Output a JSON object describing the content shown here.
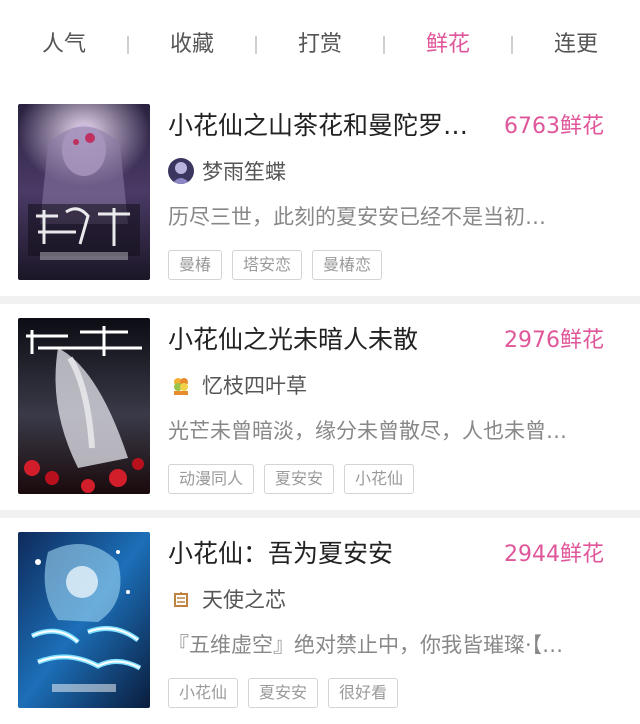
{
  "tabs": [
    {
      "label": "人气",
      "active": false
    },
    {
      "label": "收藏",
      "active": false
    },
    {
      "label": "打赏",
      "active": false
    },
    {
      "label": "鲜花",
      "active": true
    },
    {
      "label": "连更",
      "active": false
    }
  ],
  "accent_color": "#e0569a",
  "books": [
    {
      "title": "小花仙之山茶花和曼陀罗…",
      "flowers": "6763鲜花",
      "author": "梦雨笙蝶",
      "description": "历尽三世，此刻的夏安安已经不是当初…",
      "tags": [
        "曼椿",
        "塔安恋",
        "曼椿恋"
      ]
    },
    {
      "title": "小花仙之光未暗人未散",
      "flowers": "2976鲜花",
      "author": "忆枝四叶草",
      "description": "光芒未曾暗淡，缘分未曾散尽，人也未曾…",
      "tags": [
        "动漫同人",
        "夏安安",
        "小花仙"
      ]
    },
    {
      "title": "小花仙：吾为夏安安",
      "flowers": "2944鲜花",
      "author": "天使之芯",
      "description": "『五维虚空』绝对禁止中，你我皆璀璨·【…",
      "tags": [
        "小花仙",
        "夏安安",
        "很好看"
      ]
    }
  ]
}
